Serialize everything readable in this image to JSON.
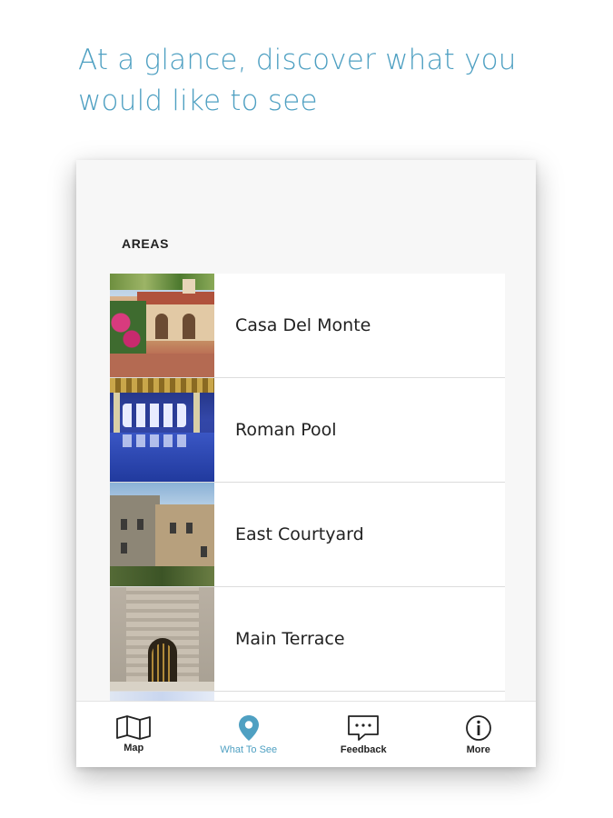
{
  "headline": {
    "line1": "At a glance, discover what you",
    "line2": "would like to see"
  },
  "section": {
    "label": "AREAS"
  },
  "areas": [
    {
      "name": "Casa Del Monte"
    },
    {
      "name": "Roman Pool"
    },
    {
      "name": "East Courtyard"
    },
    {
      "name": "Main Terrace"
    }
  ],
  "tabbar": {
    "tabs": [
      {
        "label": "Map",
        "icon": "map-icon",
        "active": false
      },
      {
        "label": "What To See",
        "icon": "location-pin-icon",
        "active": true
      },
      {
        "label": "Feedback",
        "icon": "chat-bubble-icon",
        "active": false
      },
      {
        "label": "More",
        "icon": "info-icon",
        "active": false
      }
    ]
  },
  "colors": {
    "accent": "#4fa0c2",
    "text": "#222222",
    "background": "#f7f7f7"
  }
}
